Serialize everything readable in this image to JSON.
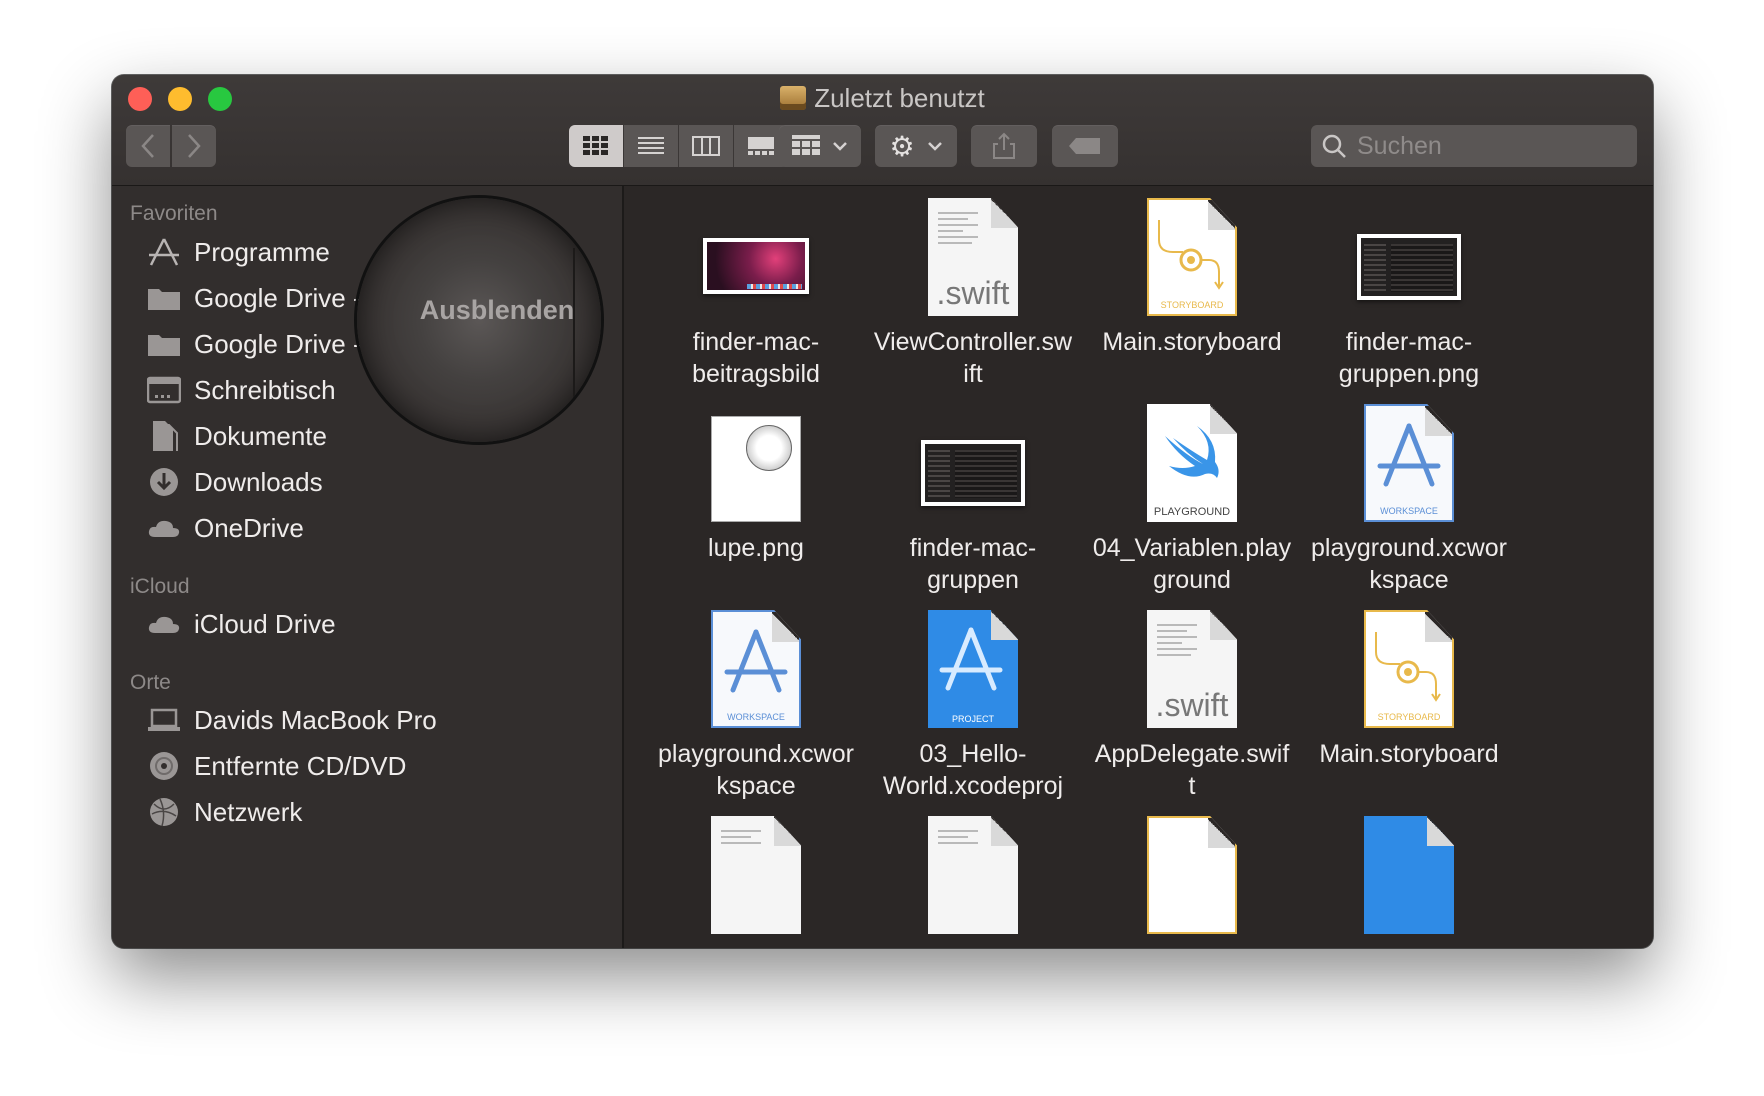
{
  "window": {
    "title": "Zuletzt benutzt"
  },
  "toolbar": {
    "search_placeholder": "Suchen"
  },
  "sidebar": {
    "hide_label": "Ausblenden",
    "sections": {
      "favorites": "Favoriten",
      "icloud": "iCloud",
      "places": "Orte"
    },
    "favorites": [
      {
        "label": "Programme",
        "icon": "applications-icon"
      },
      {
        "label": "Google Drive - a",
        "icon": "folder-icon"
      },
      {
        "label": "Google Drive - Kaindorf",
        "icon": "folder-icon"
      },
      {
        "label": "Schreibtisch",
        "icon": "desktop-icon"
      },
      {
        "label": "Dokumente",
        "icon": "documents-icon"
      },
      {
        "label": "Downloads",
        "icon": "downloads-icon"
      },
      {
        "label": "OneDrive",
        "icon": "cloud-icon"
      }
    ],
    "icloud": [
      {
        "label": "iCloud Drive",
        "icon": "icloud-icon"
      }
    ],
    "places": [
      {
        "label": "Davids MacBook Pro",
        "icon": "laptop-icon"
      },
      {
        "label": "Entfernte CD/DVD",
        "icon": "disc-icon"
      },
      {
        "label": "Netzwerk",
        "icon": "network-icon"
      }
    ]
  },
  "files": [
    {
      "name": "finder-mac-\nbeitragsbild",
      "kind": "image"
    },
    {
      "name": "ViewController.sw\nift",
      "kind": "swift",
      "ext": ".swift"
    },
    {
      "name": "Main.storyboard",
      "kind": "storyboard",
      "tag": "STORYBOARD"
    },
    {
      "name": "finder-mac-\ngruppen.png",
      "kind": "image"
    },
    {
      "name": "lupe.png",
      "kind": "image"
    },
    {
      "name": "finder-mac-\ngruppen",
      "kind": "image"
    },
    {
      "name": "04_Variablen.play\nground",
      "kind": "playground",
      "tag": "PLAYGROUND"
    },
    {
      "name": "playground.xcwor\nkspace",
      "kind": "workspace",
      "tag": "WORKSPACE"
    },
    {
      "name": "playground.xcwor\nkspace",
      "kind": "workspace",
      "tag": "WORKSPACE"
    },
    {
      "name": "03_Hello-\nWorld.xcodeproj",
      "kind": "project",
      "tag": "PROJECT"
    },
    {
      "name": "AppDelegate.swif\nt",
      "kind": "swift",
      "ext": ".swift"
    },
    {
      "name": "Main.storyboard",
      "kind": "storyboard",
      "tag": "STORYBOARD"
    }
  ],
  "colors": {
    "window_bg": "#2b2726",
    "sidebar_bg": "#322e2d",
    "accent_blue": "#2f8be6",
    "storyboard_yellow": "#e8b94b"
  }
}
